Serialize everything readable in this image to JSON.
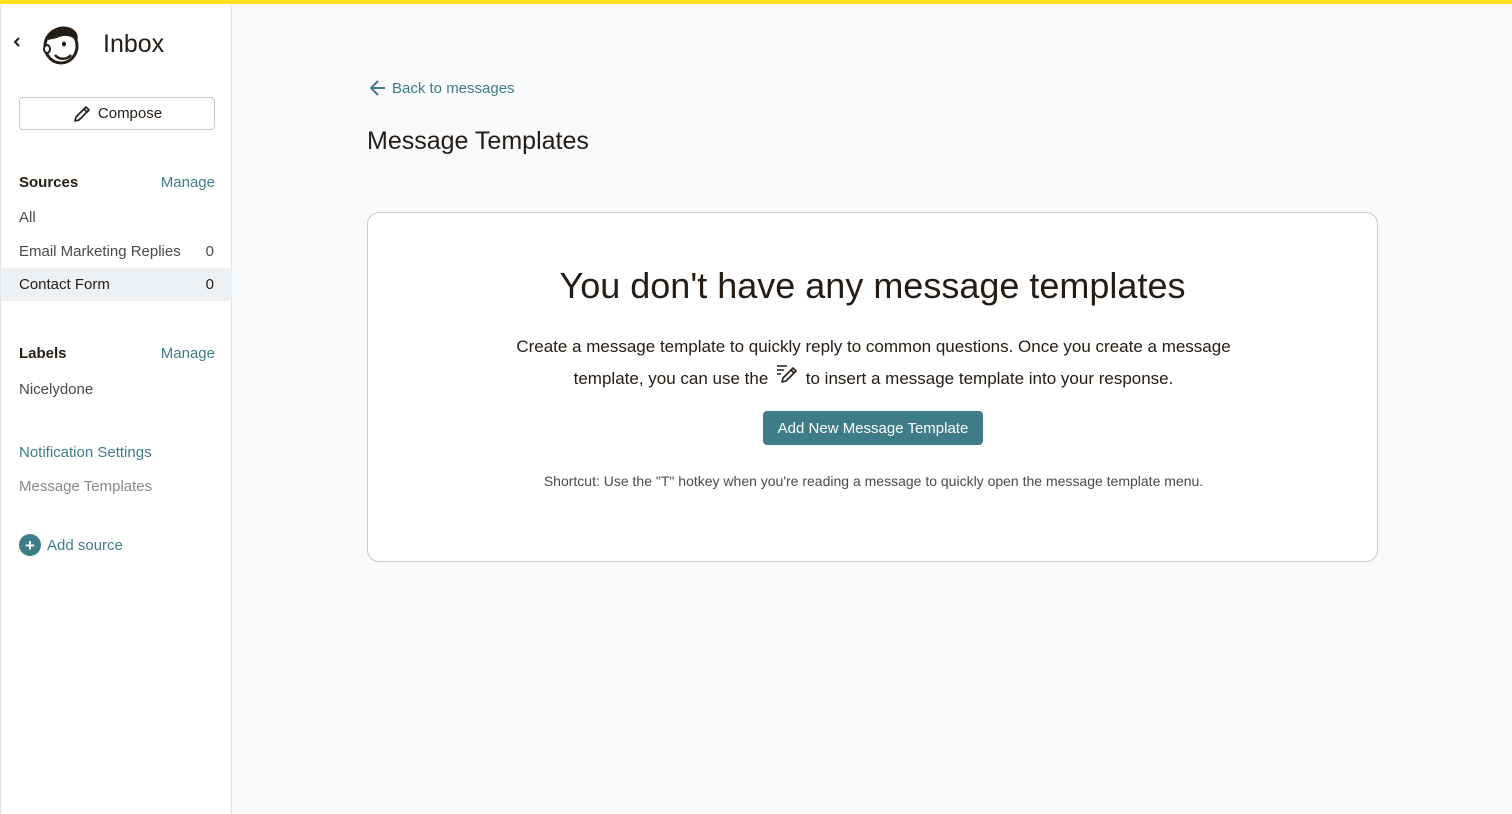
{
  "app": {
    "title": "Inbox",
    "accent_color": "#3e7d87",
    "brand_strip_color": "#ffe01b"
  },
  "sidebar": {
    "collapse_icon": "chevron-left-icon",
    "logo_icon": "freddie-logo-icon",
    "compose_label": "Compose",
    "sources": {
      "heading": "Sources",
      "manage_label": "Manage",
      "items": [
        {
          "label": "All",
          "count": ""
        },
        {
          "label": "Email Marketing Replies",
          "count": "0"
        },
        {
          "label": "Contact Form",
          "count": "0",
          "active": true
        }
      ]
    },
    "labels": {
      "heading": "Labels",
      "manage_label": "Manage",
      "items": [
        {
          "label": "Nicelydone"
        }
      ]
    },
    "notification_settings_label": "Notification Settings",
    "message_templates_label": "Message Templates",
    "add_source_label": "Add source"
  },
  "main": {
    "back_label": "Back to messages",
    "page_title": "Message Templates",
    "empty_state": {
      "title": "You don't have any message templates",
      "desc_part1": "Create a message template to quickly reply to common questions. Once you create a message template, you can use the",
      "desc_part2": "to insert a message template into your response.",
      "button_label": "Add New Message Template",
      "shortcut": "Shortcut: Use the \"T\" hotkey when you're reading a message to quickly open the message template menu."
    }
  }
}
